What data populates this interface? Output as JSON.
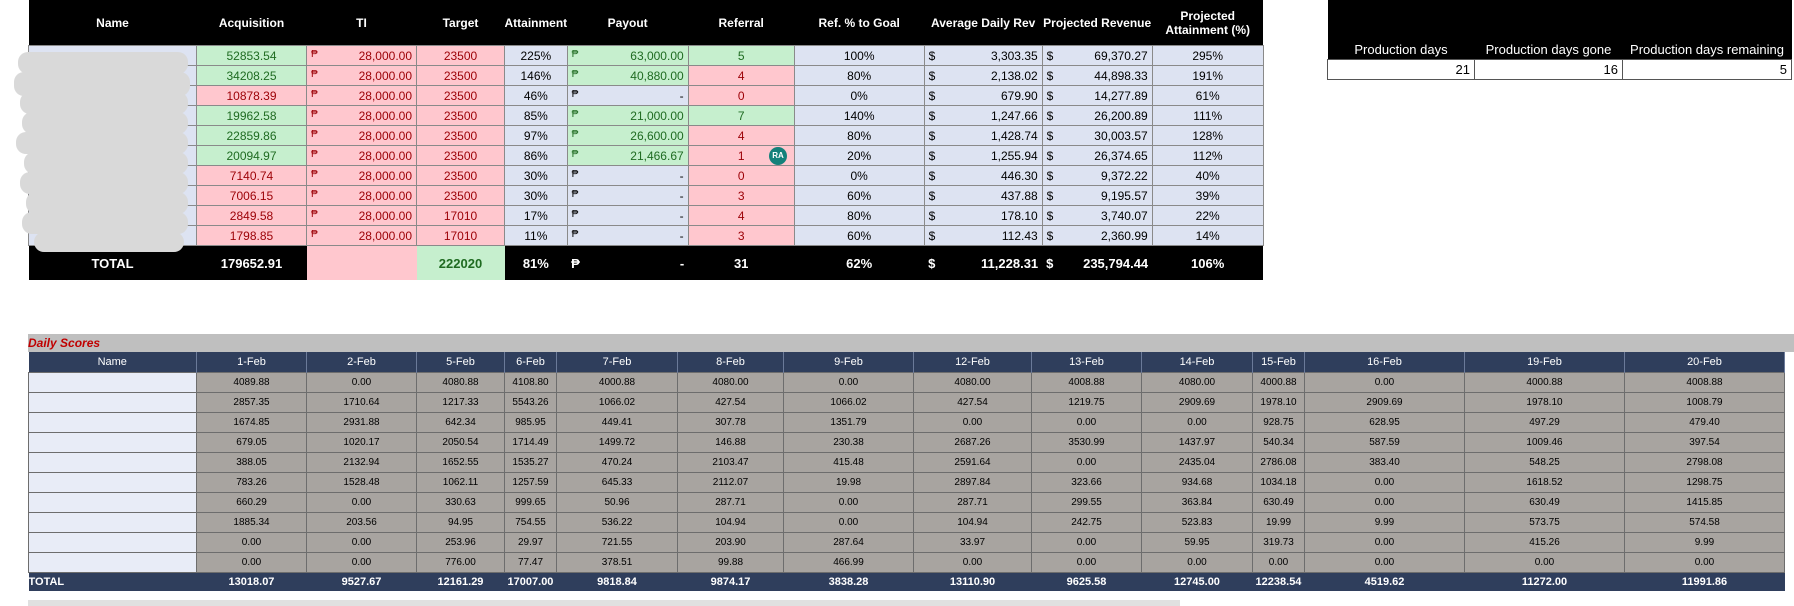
{
  "top_table": {
    "headers": [
      "Name",
      "Acquisition",
      "TI",
      "Target",
      "Attainment",
      "Payout",
      "Referral",
      "Ref. % to Goal",
      "Average Daily Rev",
      "Projected Revenue",
      "Projected Attainment (%)"
    ],
    "rows": [
      {
        "acq": "52853.54",
        "acq_status": "g",
        "ti": "28,000.00",
        "target": "23500",
        "att": "225%",
        "payout": "63,000.00",
        "payout_status": "g",
        "ref": "5",
        "ref_status": "g",
        "refpct": "100%",
        "adr": "3,303.35",
        "prev": "69,370.27",
        "patt": "295%"
      },
      {
        "acq": "34208.25",
        "acq_status": "g",
        "ti": "28,000.00",
        "target": "23500",
        "att": "146%",
        "payout": "40,880.00",
        "payout_status": "g",
        "ref": "4",
        "ref_status": "r",
        "refpct": "80%",
        "adr": "2,138.02",
        "prev": "44,898.33",
        "patt": "191%"
      },
      {
        "acq": "10878.39",
        "acq_status": "r",
        "ti": "28,000.00",
        "target": "23500",
        "att": "46%",
        "payout": "-",
        "payout_status": "b",
        "ref": "0",
        "ref_status": "r",
        "refpct": "0%",
        "adr": "679.90",
        "prev": "14,277.89",
        "patt": "61%"
      },
      {
        "acq": "19962.58",
        "acq_status": "g",
        "ti": "28,000.00",
        "target": "23500",
        "att": "85%",
        "payout": "21,000.00",
        "payout_status": "g",
        "ref": "7",
        "ref_status": "g",
        "refpct": "140%",
        "adr": "1,247.66",
        "prev": "26,200.89",
        "patt": "111%"
      },
      {
        "acq": "22859.86",
        "acq_status": "g",
        "ti": "28,000.00",
        "target": "23500",
        "att": "97%",
        "payout": "26,600.00",
        "payout_status": "g",
        "ref": "4",
        "ref_status": "r",
        "refpct": "80%",
        "adr": "1,428.74",
        "prev": "30,003.57",
        "patt": "128%"
      },
      {
        "acq": "20094.97",
        "acq_status": "g",
        "ti": "28,000.00",
        "target": "23500",
        "att": "86%",
        "payout": "21,466.67",
        "payout_status": "g",
        "ref": "1",
        "ref_status": "r",
        "refpct": "20%",
        "adr": "1,255.94",
        "prev": "26,374.65",
        "patt": "112%"
      },
      {
        "acq": "7140.74",
        "acq_status": "r",
        "ti": "28,000.00",
        "target": "23500",
        "att": "30%",
        "payout": "-",
        "payout_status": "b",
        "ref": "0",
        "ref_status": "r",
        "refpct": "0%",
        "adr": "446.30",
        "prev": "9,372.22",
        "patt": "40%"
      },
      {
        "acq": "7006.15",
        "acq_status": "r",
        "ti": "28,000.00",
        "target": "23500",
        "att": "30%",
        "payout": "-",
        "payout_status": "b",
        "ref": "3",
        "ref_status": "r",
        "refpct": "60%",
        "adr": "437.88",
        "prev": "9,195.57",
        "patt": "39%"
      },
      {
        "acq": "2849.58",
        "acq_status": "r",
        "ti": "28,000.00",
        "target": "17010",
        "att": "17%",
        "payout": "-",
        "payout_status": "b",
        "ref": "4",
        "ref_status": "r",
        "refpct": "80%",
        "adr": "178.10",
        "prev": "3,740.07",
        "patt": "22%"
      },
      {
        "acq": "1798.85",
        "acq_status": "r",
        "ti": "28,000.00",
        "target": "17010",
        "att": "11%",
        "payout": "-",
        "payout_status": "b",
        "ref": "3",
        "ref_status": "r",
        "refpct": "60%",
        "adr": "112.43",
        "prev": "2,360.99",
        "patt": "14%"
      }
    ],
    "total": {
      "label": "TOTAL",
      "acq": "179652.91",
      "target": "222020",
      "att": "81%",
      "payout": "-",
      "ref": "31",
      "refpct": "62%",
      "adr": "11,228.31",
      "prev": "235,794.44",
      "patt": "106%"
    },
    "peso_symbol": "₱",
    "usd_symbol": "$"
  },
  "production": {
    "headers": [
      "Production days",
      "Production days gone",
      "Production days remaining"
    ],
    "values": [
      "21",
      "16",
      "5"
    ]
  },
  "avatar_initials": "RA",
  "daily_scores": {
    "title": "Daily Scores",
    "headers": [
      "Name",
      "1-Feb",
      "2-Feb",
      "5-Feb",
      "6-Feb",
      "7-Feb",
      "8-Feb",
      "9-Feb",
      "12-Feb",
      "13-Feb",
      "14-Feb",
      "15-Feb",
      "16-Feb",
      "19-Feb",
      "20-Feb"
    ],
    "rows": [
      [
        "4089.88",
        "0.00",
        "4080.88",
        "4108.80",
        "4000.88",
        "4080.00",
        "0.00",
        "4080.00",
        "4008.88",
        "4080.00",
        "4000.88",
        "0.00",
        "4000.88",
        "4008.88"
      ],
      [
        "2857.35",
        "1710.64",
        "1217.33",
        "5543.26",
        "1066.02",
        "427.54",
        "1066.02",
        "427.54",
        "1219.75",
        "2909.69",
        "1978.10",
        "2909.69",
        "1978.10",
        "1008.79"
      ],
      [
        "1674.85",
        "2931.88",
        "642.34",
        "985.95",
        "449.41",
        "307.78",
        "1351.79",
        "0.00",
        "0.00",
        "0.00",
        "928.75",
        "628.95",
        "497.29",
        "479.40"
      ],
      [
        "679.05",
        "1020.17",
        "2050.54",
        "1714.49",
        "1499.72",
        "146.88",
        "230.38",
        "2687.26",
        "3530.99",
        "1437.97",
        "540.34",
        "587.59",
        "1009.46",
        "397.54"
      ],
      [
        "388.05",
        "2132.94",
        "1652.55",
        "1535.27",
        "470.24",
        "2103.47",
        "415.48",
        "2591.64",
        "0.00",
        "2435.04",
        "2786.08",
        "383.40",
        "548.25",
        "2798.08"
      ],
      [
        "783.26",
        "1528.48",
        "1062.11",
        "1257.59",
        "645.33",
        "2112.07",
        "19.98",
        "2897.84",
        "323.66",
        "934.68",
        "1034.18",
        "0.00",
        "1618.52",
        "1298.75"
      ],
      [
        "660.29",
        "0.00",
        "330.63",
        "999.65",
        "50.96",
        "287.71",
        "0.00",
        "287.71",
        "299.55",
        "363.84",
        "630.49",
        "0.00",
        "630.49",
        "1415.85"
      ],
      [
        "1885.34",
        "203.56",
        "94.95",
        "754.55",
        "536.22",
        "104.94",
        "0.00",
        "104.94",
        "242.75",
        "523.83",
        "19.99",
        "9.99",
        "573.75",
        "574.58"
      ],
      [
        "0.00",
        "0.00",
        "253.96",
        "29.97",
        "721.55",
        "203.90",
        "287.64",
        "33.97",
        "0.00",
        "59.95",
        "319.73",
        "0.00",
        "415.26",
        "9.99"
      ],
      [
        "0.00",
        "0.00",
        "776.00",
        "77.47",
        "378.51",
        "99.88",
        "466.99",
        "0.00",
        "0.00",
        "0.00",
        "0.00",
        "0.00",
        "0.00",
        "0.00"
      ]
    ],
    "total": [
      "TOTAL",
      "13018.07",
      "9527.67",
      "12161.29",
      "17007.00",
      "9818.84",
      "9874.17",
      "3838.28",
      "13110.90",
      "9625.58",
      "12745.00",
      "12238.54",
      "4519.62",
      "11272.00",
      "11991.86"
    ]
  }
}
